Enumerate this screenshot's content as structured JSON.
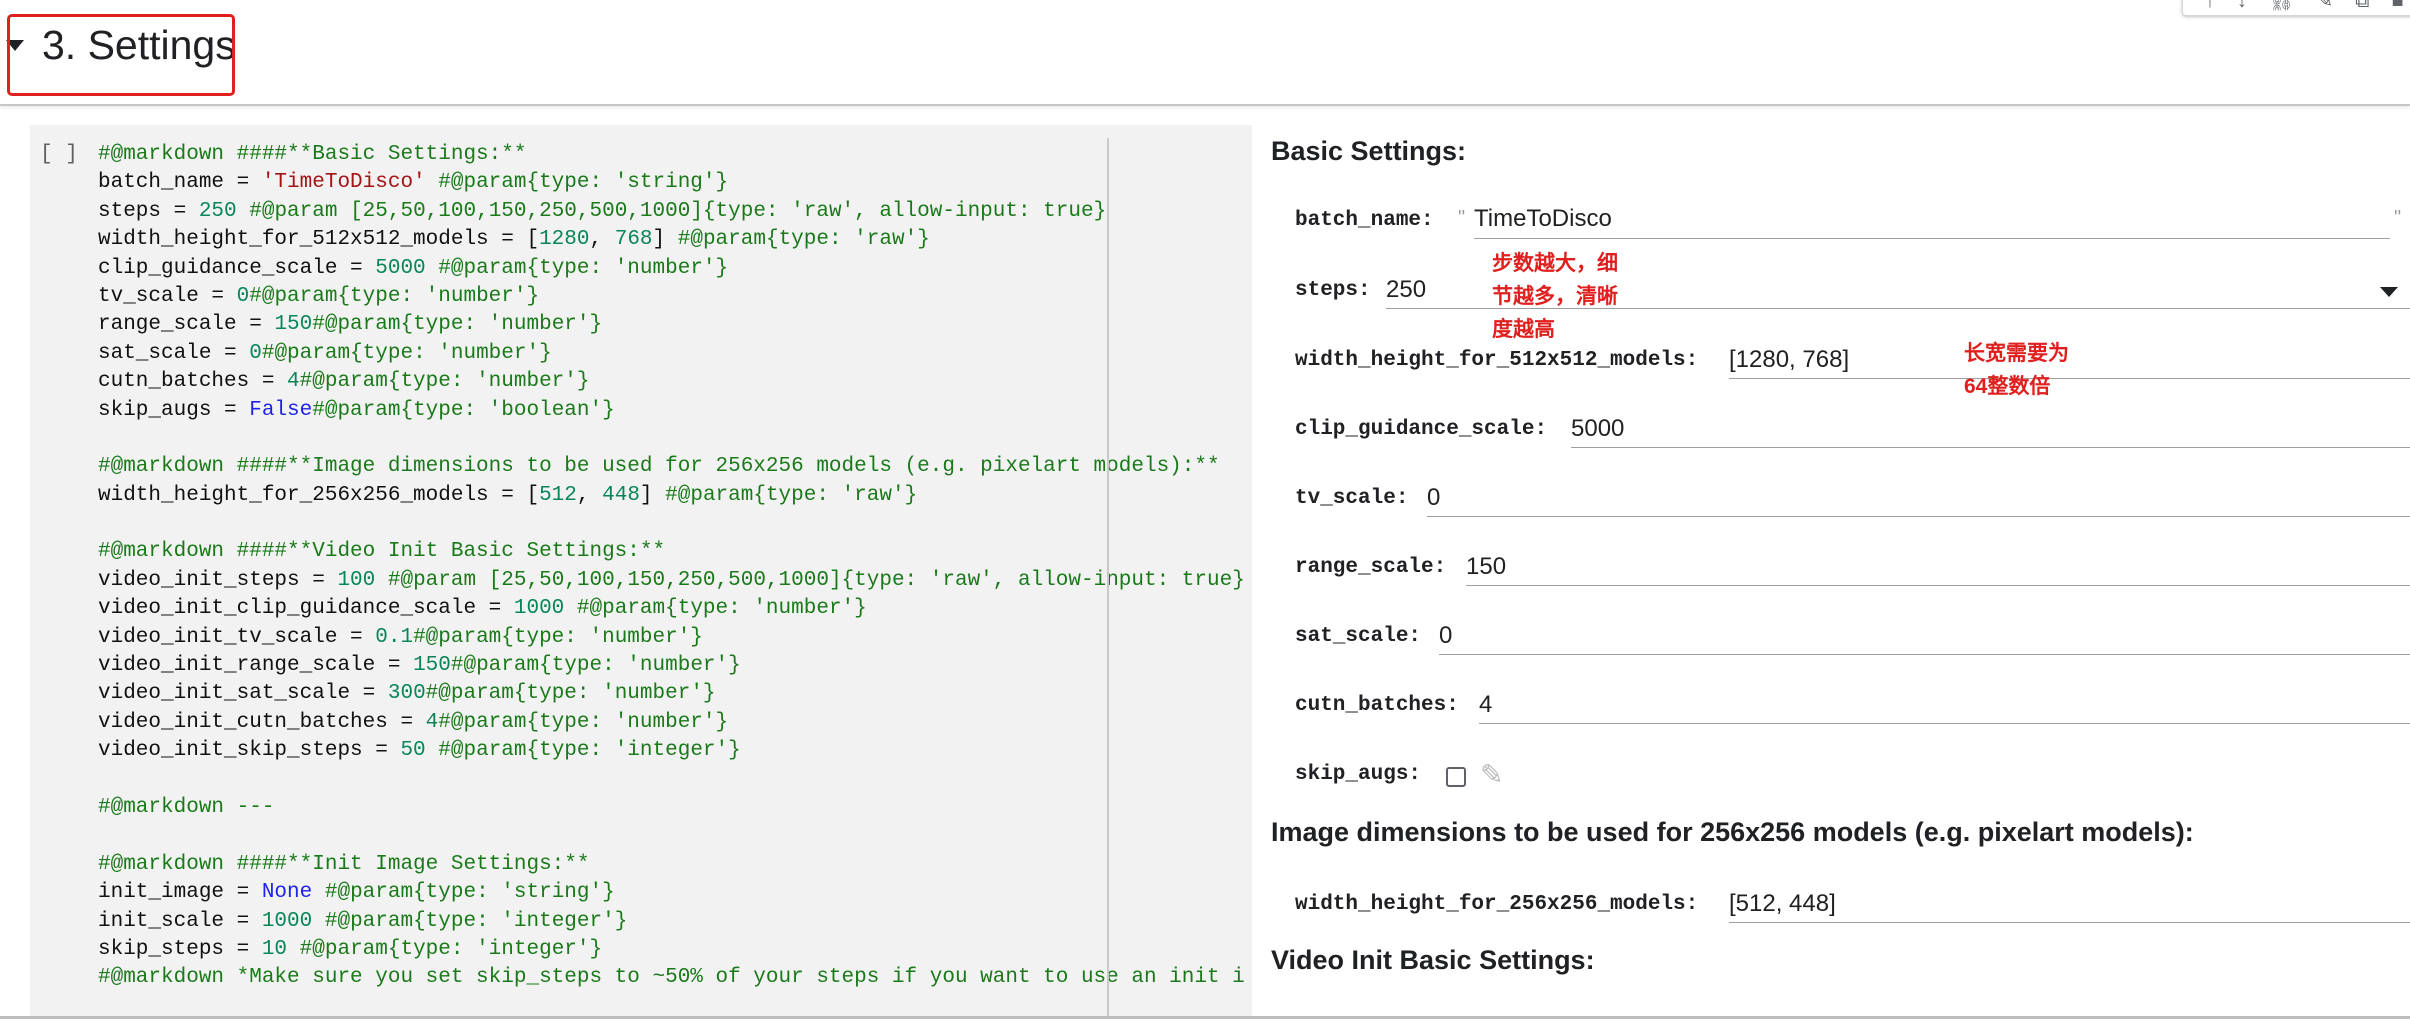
{
  "toolbar": {
    "icons": [
      "arrow-up-icon",
      "arrow-down-icon",
      "link-icon",
      "edit-icon",
      "mirror-icon",
      "delete-icon"
    ],
    "glyphs": [
      "↑",
      "↓",
      "⛓",
      "✎",
      "⧉",
      "■"
    ]
  },
  "section": {
    "title": "3. Settings",
    "highlight_color": "#e0201f"
  },
  "code_cell": {
    "run_bracket": "[ ]",
    "lines": [
      "#@markdown ####**Basic Settings:**",
      "batch_name = 'TimeToDisco' #@param{type: 'string'}",
      "steps = 250 #@param [25,50,100,150,250,500,1000]{type: 'raw', allow-input: true}",
      "width_height_for_512x512_models = [1280, 768] #@param{type: 'raw'}",
      "clip_guidance_scale = 5000 #@param{type: 'number'}",
      "tv_scale = 0#@param{type: 'number'}",
      "range_scale = 150#@param{type: 'number'}",
      "sat_scale = 0#@param{type: 'number'}",
      "cutn_batches = 4#@param{type: 'number'}",
      "skip_augs = False#@param{type: 'boolean'}",
      "",
      "#@markdown ####**Image dimensions to be used for 256x256 models (e.g. pixelart models):**",
      "width_height_for_256x256_models = [512, 448] #@param{type: 'raw'}",
      "",
      "#@markdown ####**Video Init Basic Settings:**",
      "video_init_steps = 100 #@param [25,50,100,150,250,500,1000]{type: 'raw', allow-input: true}",
      "video_init_clip_guidance_scale = 1000 #@param{type: 'number'}",
      "video_init_tv_scale = 0.1#@param{type: 'number'}",
      "video_init_range_scale = 150#@param{type: 'number'}",
      "video_init_sat_scale = 300#@param{type: 'number'}",
      "video_init_cutn_batches = 4#@param{type: 'number'}",
      "video_init_skip_steps = 50 #@param{type: 'integer'}",
      "",
      "#@markdown ---",
      "",
      "#@markdown ####**Init Image Settings:**",
      "init_image = None #@param{type: 'string'}",
      "init_scale = 1000 #@param{type: 'integer'}",
      "skip_steps = 10 #@param{type: 'integer'}",
      "#@markdown *Make sure you set skip_steps to ~50% of your steps if you want to use an init i"
    ]
  },
  "form": {
    "heading_basic": "Basic Settings:",
    "heading_image_dims": "Image dimensions to be used for 256x256 models (e.g. pixelart models):",
    "heading_video_init": "Video Init Basic Settings:",
    "fields": {
      "batch_name": {
        "label": "batch_name:",
        "value": "TimeToDisco",
        "quote_open": "\"",
        "quote_close": "\""
      },
      "steps": {
        "label": "steps:",
        "value": "250"
      },
      "width_height_512": {
        "label": "width_height_for_512x512_models:",
        "value": "[1280, 768]"
      },
      "clip_guidance_scale": {
        "label": "clip_guidance_scale:",
        "value": "5000"
      },
      "tv_scale": {
        "label": "tv_scale:",
        "value": "0"
      },
      "range_scale": {
        "label": "range_scale:",
        "value": "150"
      },
      "sat_scale": {
        "label": "sat_scale:",
        "value": "0"
      },
      "cutn_batches": {
        "label": "cutn_batches:",
        "value": "4"
      },
      "skip_augs": {
        "label": "skip_augs:",
        "checked": false
      },
      "width_height_256": {
        "label": "width_height_for_256x256_models:",
        "value": "[512, 448]"
      }
    }
  },
  "annotations": {
    "steps_note_line1": "步数越大，细",
    "steps_note_line2": "节越多，清晰",
    "steps_note_line3": "度越高",
    "size_note_line1": "长宽需要为",
    "size_note_line2": "64整数倍"
  },
  "icons": {
    "edit_field_icon": "pencil-icon",
    "edit_field_glyph": "✎"
  }
}
